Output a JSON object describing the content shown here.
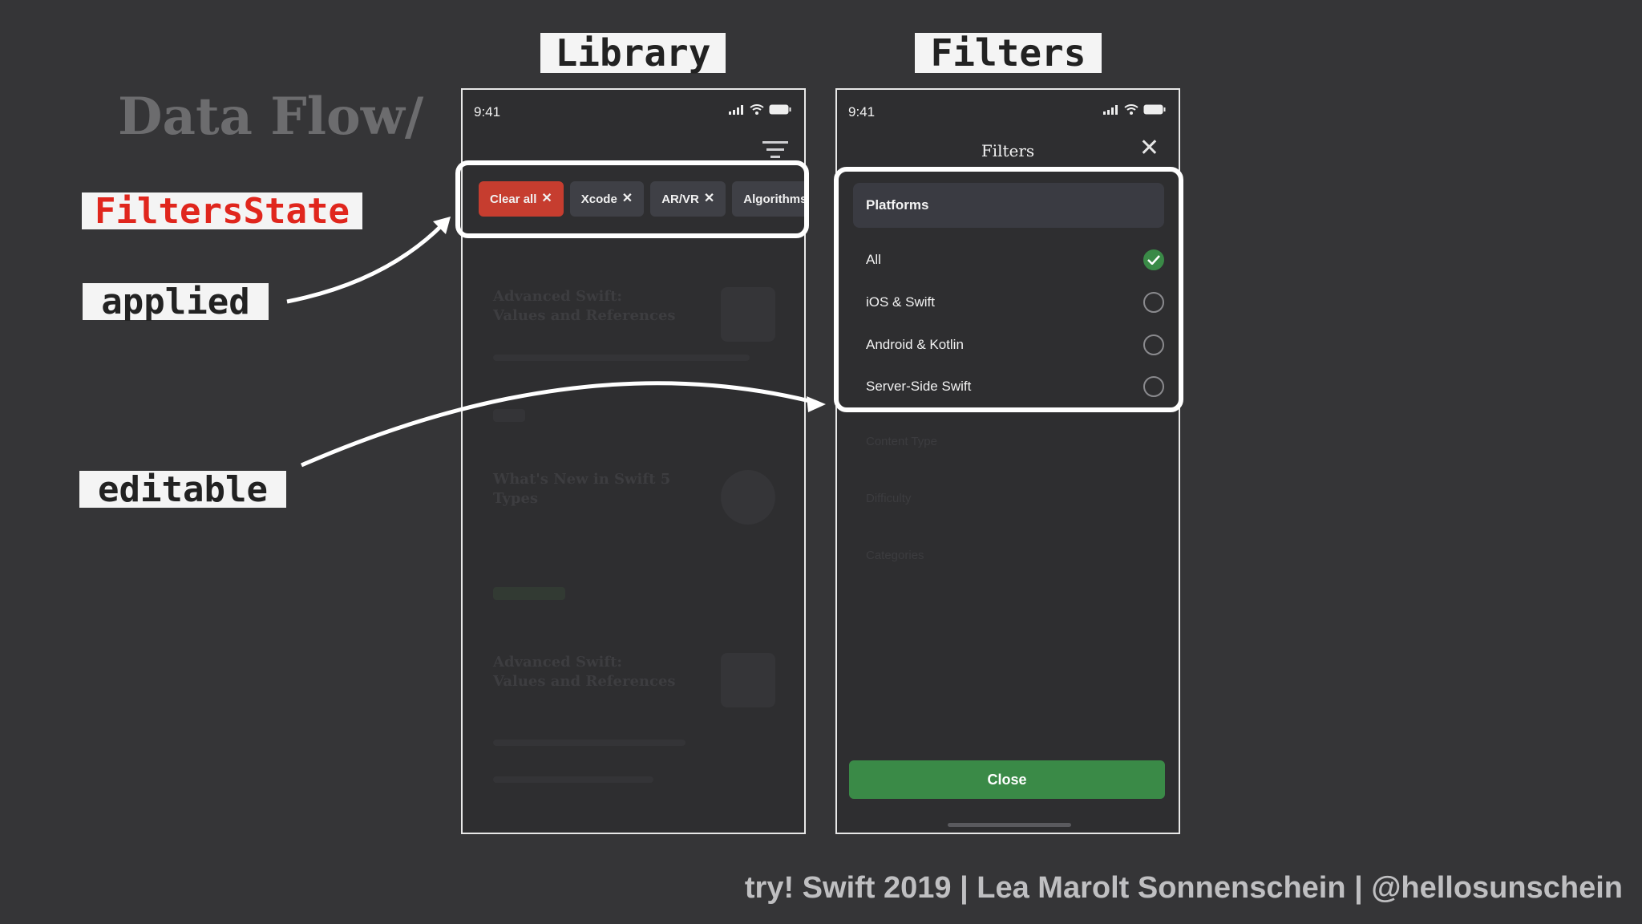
{
  "slide": {
    "title": "Data Flow/",
    "label_library": "Library",
    "label_filters": "Filters",
    "label_filtersstate": "FiltersState",
    "label_applied": "applied",
    "label_editable": "editable",
    "footer": "try! Swift 2019 | Lea Marolt Sonnenschein | @hellosunschein",
    "accent_red": "#e0261d"
  },
  "library_screen": {
    "status_time": "9:41",
    "chips": [
      {
        "label": "Clear all",
        "variant": "clear",
        "icon": "close-icon"
      },
      {
        "label": "Xcode",
        "variant": "default",
        "icon": "close-icon"
      },
      {
        "label": "AR/VR",
        "variant": "default",
        "icon": "close-icon"
      },
      {
        "label": "Algorithms",
        "variant": "default",
        "icon": ""
      }
    ],
    "faded_items": [
      {
        "title_line1": "Advanced Swift:",
        "title_line2": "Values and References"
      },
      {
        "title_line1": "What's New in Swift 5",
        "title_line2": "Types"
      },
      {
        "title_line1": "Advanced Swift:",
        "title_line2": "Values and References"
      }
    ]
  },
  "filters_screen": {
    "status_time": "9:41",
    "title": "Filters",
    "section_title": "Platforms",
    "options": [
      {
        "label": "All",
        "checked": true
      },
      {
        "label": "iOS & Swift",
        "checked": false
      },
      {
        "label": "Android & Kotlin",
        "checked": false
      },
      {
        "label": "Server-Side Swift",
        "checked": false
      }
    ],
    "faded_sections": [
      "Content Type",
      "Difficulty",
      "Categories"
    ],
    "close_label": "Close",
    "check_color": "#3a8a47"
  }
}
